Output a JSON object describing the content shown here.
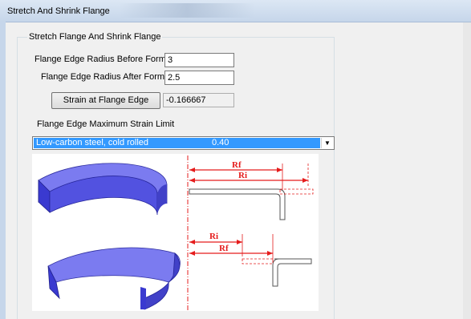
{
  "window": {
    "title": "Stretch And Shrink Flange"
  },
  "group": {
    "title": "Stretch Flange And Shrink Flange"
  },
  "fields": {
    "ri_label": "Flange Edge Radius Before Forming, Ri :",
    "ri_value": "3",
    "rf_label": "Flange Edge Radius After Forming, Rf:",
    "rf_value": "2.5"
  },
  "strain": {
    "button_label": "Strain at Flange Edge",
    "value": "-0.166667"
  },
  "limit": {
    "label": "Flange Edge Maximum Strain Limit",
    "selected_material": "Low-carbon steel, cold rolled",
    "selected_value": "0.40"
  },
  "figure": {
    "labels": {
      "rf": "Rf",
      "ri": "Ri"
    },
    "colors": {
      "part": "#5a5ae6",
      "dimension": "#e51c1c"
    }
  }
}
